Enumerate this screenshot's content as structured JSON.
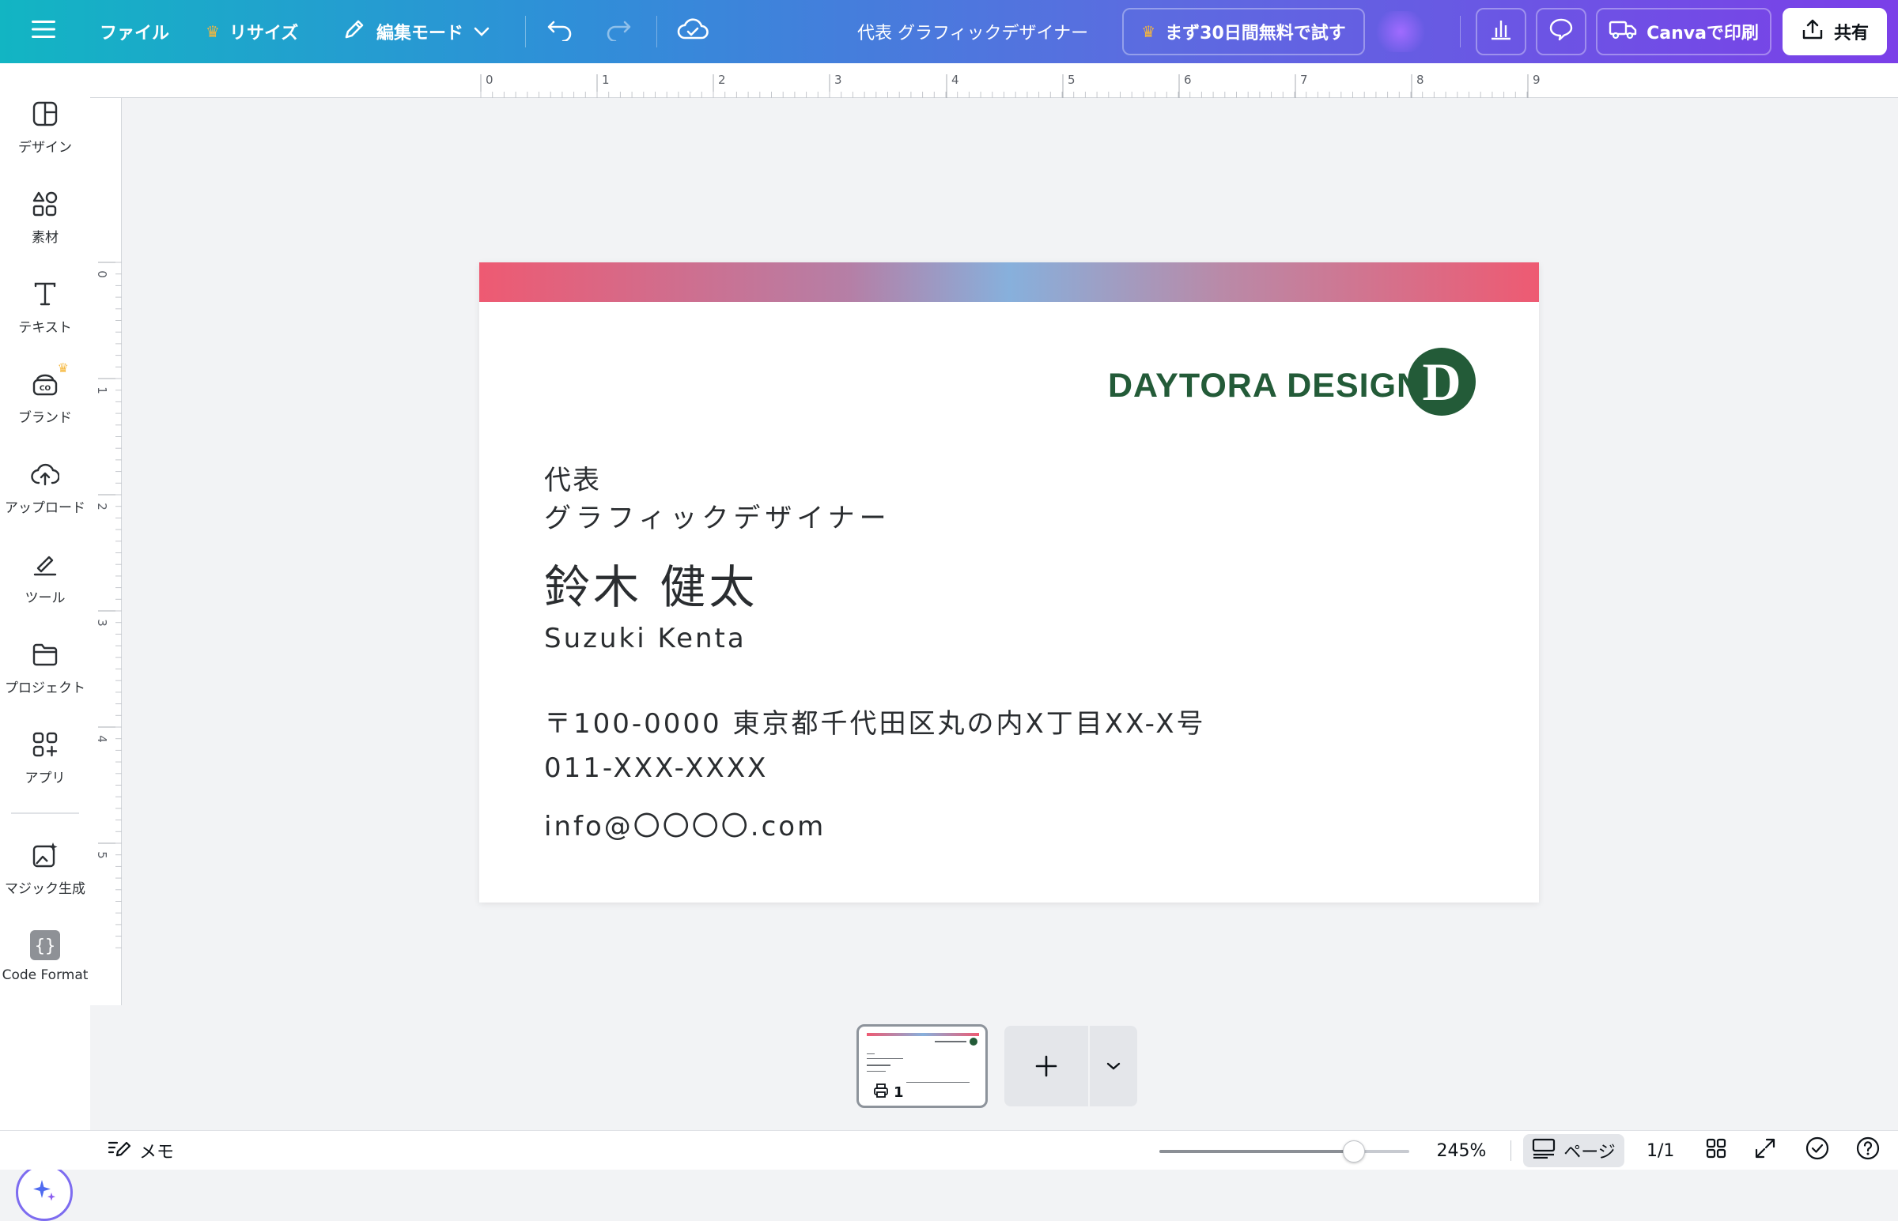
{
  "topbar": {
    "menu_icon": "hamburger-icon",
    "file": "ファイル",
    "resize": "リサイズ",
    "edit_mode": "編集モード",
    "doc_title": "代表 グラフィックデザイナー",
    "trial": "まず30日間無料で試す",
    "print": "Canvaで印刷",
    "share": "共有"
  },
  "sidebar": {
    "items": [
      {
        "label": "デザイン",
        "icon": "design-icon"
      },
      {
        "label": "素材",
        "icon": "elements-icon"
      },
      {
        "label": "テキスト",
        "icon": "text-icon"
      },
      {
        "label": "ブランド",
        "icon": "brand-icon"
      },
      {
        "label": "アップロード",
        "icon": "upload-icon"
      },
      {
        "label": "ツール",
        "icon": "tools-icon"
      },
      {
        "label": "プロジェクト",
        "icon": "projects-icon"
      },
      {
        "label": "アプリ",
        "icon": "apps-icon"
      },
      {
        "label": "マジック生成",
        "icon": "magic-media-icon"
      },
      {
        "label": "Code Format",
        "icon": "code-format-icon"
      }
    ]
  },
  "rulers": {
    "top": [
      "0",
      "1",
      "2",
      "3",
      "4",
      "5",
      "6",
      "7",
      "8",
      "9"
    ],
    "left": [
      "0",
      "1",
      "2",
      "3",
      "4",
      "5"
    ]
  },
  "card": {
    "logo_text": "DAYTORA DESIGN",
    "logo_letter": "D",
    "title_line1": "代表",
    "title_line2": "グラフィックデザイナー",
    "name_jp": "鈴木 健太",
    "name_en": "Suzuki Kenta",
    "address": "〒100-0000 東京都千代田区丸の内X丁目XX-X号",
    "phone": "011-XXX-XXXX",
    "email": "info@〇〇〇〇.com",
    "band_colors": [
      "#ee5a72",
      "#87b0dc"
    ]
  },
  "pages": {
    "thumb_number": "1"
  },
  "bottombar": {
    "notes": "メモ",
    "zoom": "245%",
    "zoom_fraction": 0.78,
    "page_view": "ページ",
    "page_count": "1/1"
  },
  "colors": {
    "brand_green": "#235b38",
    "accent_purple": "#7d6cf0"
  }
}
